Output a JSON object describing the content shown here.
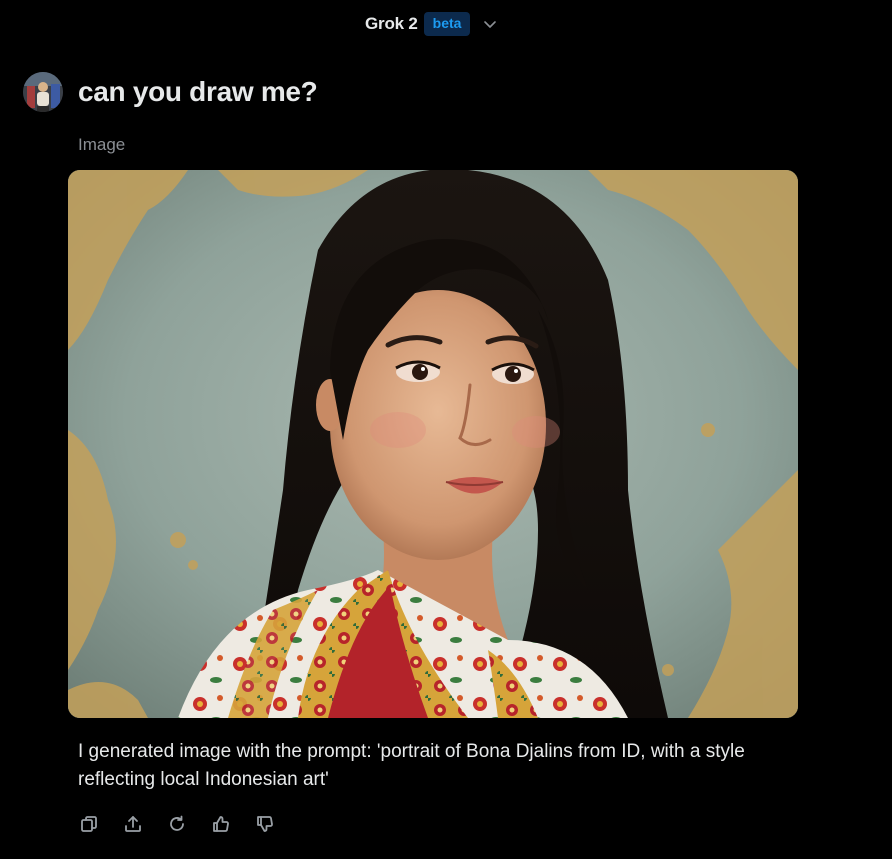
{
  "header": {
    "model_name": "Grok 2",
    "badge": "beta",
    "dropdown_icon": "chevron-down-icon"
  },
  "message": {
    "avatar_icon": "user-avatar",
    "prompt": "can you draw me?"
  },
  "response": {
    "attachment_label": "Image",
    "text": "I generated image with the prompt: 'portrait of Bona Djalins from ID, with a style reflecting local Indonesian art'"
  },
  "actions": [
    {
      "name": "copy-icon"
    },
    {
      "name": "share-icon"
    },
    {
      "name": "regenerate-icon"
    },
    {
      "name": "thumbs-up-icon"
    },
    {
      "name": "thumbs-down-icon"
    }
  ],
  "colors": {
    "background": "#000000",
    "text_primary": "#e7e9ea",
    "text_muted": "#8b8f94",
    "badge_bg": "#0c2a4d",
    "badge_text": "#1d9bf0",
    "icon": "#9aa0a6"
  }
}
